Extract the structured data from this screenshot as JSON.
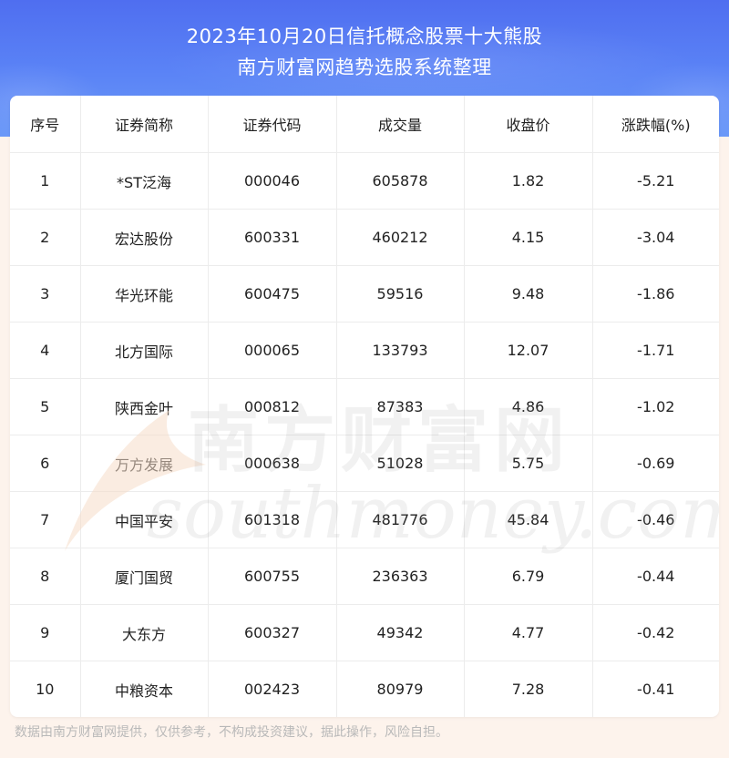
{
  "header": {
    "title_line1": "2023年10月20日信托概念股票十大熊股",
    "title_line2": "南方财富网趋势选股系统整理"
  },
  "table": {
    "columns": [
      "序号",
      "证券简称",
      "证券代码",
      "成交量",
      "收盘价",
      "涨跌幅(%)"
    ],
    "rows": [
      [
        "1",
        "*ST泛海",
        "000046",
        "605878",
        "1.82",
        "-5.21"
      ],
      [
        "2",
        "宏达股份",
        "600331",
        "460212",
        "4.15",
        "-3.04"
      ],
      [
        "3",
        "华光环能",
        "600475",
        "59516",
        "9.48",
        "-1.86"
      ],
      [
        "4",
        "北方国际",
        "000065",
        "133793",
        "12.07",
        "-1.71"
      ],
      [
        "5",
        "陕西金叶",
        "000812",
        "87383",
        "4.86",
        "-1.02"
      ],
      [
        "6",
        "万方发展",
        "000638",
        "51028",
        "5.75",
        "-0.69"
      ],
      [
        "7",
        "中国平安",
        "601318",
        "481776",
        "45.84",
        "-0.46"
      ],
      [
        "8",
        "厦门国贸",
        "600755",
        "236363",
        "6.79",
        "-0.44"
      ],
      [
        "9",
        "大东方",
        "600327",
        "49342",
        "4.77",
        "-0.42"
      ],
      [
        "10",
        "中粮资本",
        "002423",
        "80979",
        "7.28",
        "-0.41"
      ]
    ]
  },
  "watermark": {
    "cn": "南方财富网",
    "en": "southmoney.com"
  },
  "footer": {
    "disclaimer": "数据由南方财富网提供，仅供参考，不构成投资建议，据此操作，风险自担。"
  }
}
